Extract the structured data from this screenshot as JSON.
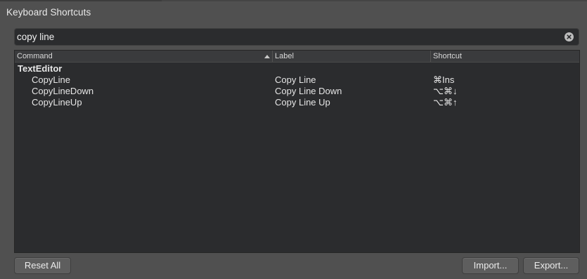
{
  "window": {
    "title": "Keyboard Shortcuts"
  },
  "search": {
    "value": "copy line",
    "placeholder": ""
  },
  "table": {
    "headers": {
      "command": "Command",
      "label": "Label",
      "shortcut": "Shortcut"
    },
    "group": "TextEditor",
    "rows": [
      {
        "command": "CopyLine",
        "label": "Copy Line",
        "shortcut": "⌘Ins"
      },
      {
        "command": "CopyLineDown",
        "label": "Copy Line Down",
        "shortcut": "⌥⌘↓"
      },
      {
        "command": "CopyLineUp",
        "label": "Copy Line Up",
        "shortcut": "⌥⌘↑"
      }
    ]
  },
  "buttons": {
    "reset": "Reset All",
    "import": "Import...",
    "export": "Export..."
  },
  "icons": {
    "clear": "clear-circle-icon",
    "sort": "sort-ascending-icon"
  }
}
